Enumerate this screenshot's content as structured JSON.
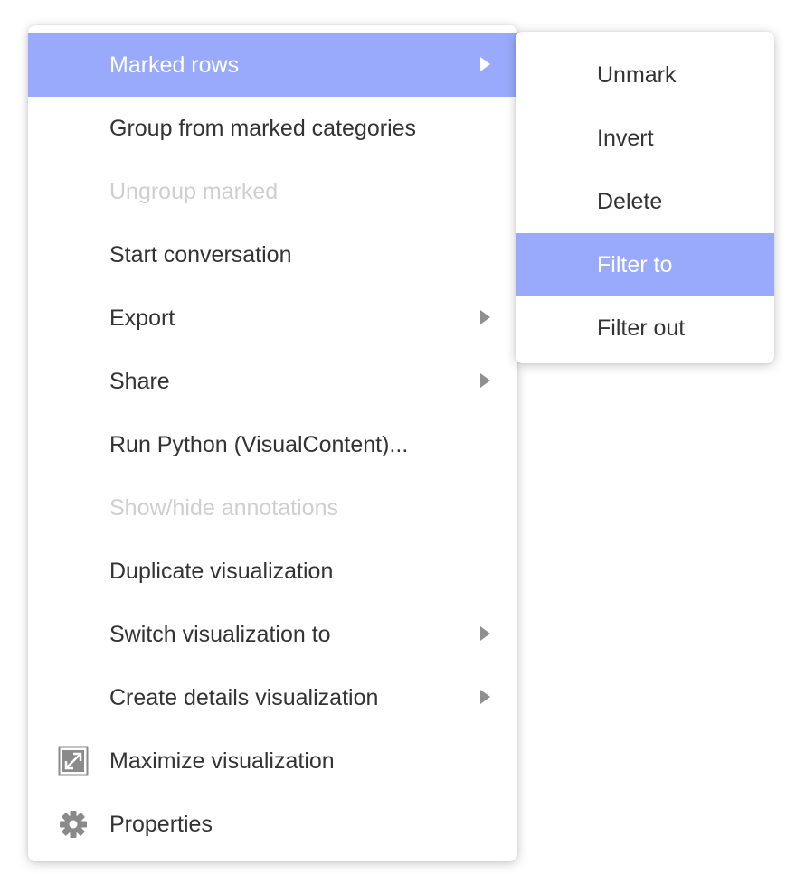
{
  "main_menu": {
    "items": [
      {
        "label": "Marked rows",
        "icon": "",
        "submenu": true,
        "state": "highlighted"
      },
      {
        "label": "Group from marked categories",
        "icon": "",
        "submenu": false,
        "state": "enabled"
      },
      {
        "label": "Ungroup marked",
        "icon": "",
        "submenu": false,
        "state": "disabled"
      },
      {
        "label": "Start conversation",
        "icon": "",
        "submenu": false,
        "state": "enabled"
      },
      {
        "label": "Export",
        "icon": "",
        "submenu": true,
        "state": "enabled"
      },
      {
        "label": "Share",
        "icon": "",
        "submenu": true,
        "state": "enabled"
      },
      {
        "label": "Run Python (VisualContent)...",
        "icon": "",
        "submenu": false,
        "state": "enabled"
      },
      {
        "label": "Show/hide annotations",
        "icon": "",
        "submenu": false,
        "state": "disabled"
      },
      {
        "label": "Duplicate visualization",
        "icon": "",
        "submenu": false,
        "state": "enabled"
      },
      {
        "label": "Switch visualization to",
        "icon": "",
        "submenu": true,
        "state": "enabled"
      },
      {
        "label": "Create details visualization",
        "icon": "",
        "submenu": true,
        "state": "enabled"
      },
      {
        "label": "Maximize visualization",
        "icon": "maximize-icon",
        "submenu": false,
        "state": "enabled"
      },
      {
        "label": "Properties",
        "icon": "gear-icon",
        "submenu": false,
        "state": "enabled"
      }
    ]
  },
  "sub_menu": {
    "items": [
      {
        "label": "Unmark",
        "state": "enabled"
      },
      {
        "label": "Invert",
        "state": "enabled"
      },
      {
        "label": "Delete",
        "state": "enabled"
      },
      {
        "label": "Filter to",
        "state": "highlighted"
      },
      {
        "label": "Filter out",
        "state": "enabled"
      }
    ]
  },
  "colors": {
    "highlight": "#99aafc",
    "text": "#333333",
    "disabled_text": "#cfcfcf",
    "arrow": "#8f8f8f",
    "icon": "#8a8a8a"
  }
}
